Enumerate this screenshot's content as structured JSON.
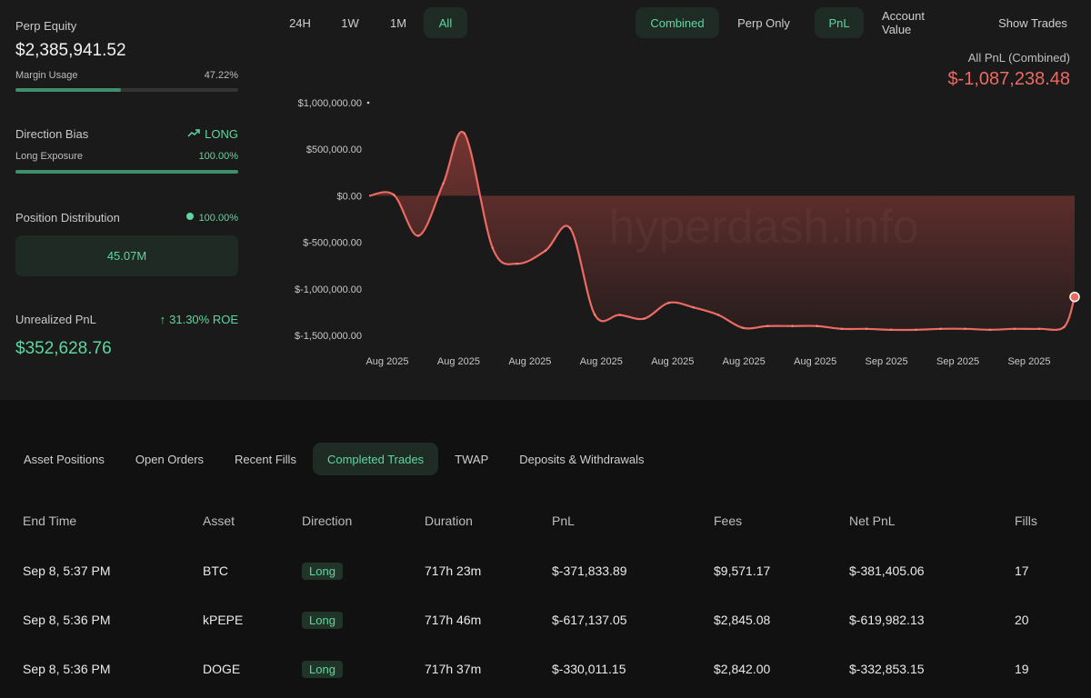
{
  "stats": {
    "perp_equity_label": "Perp Equity",
    "perp_equity_value": "$2,385,941.52",
    "margin_usage_label": "Margin Usage",
    "margin_usage_value": "47.22%",
    "margin_usage_fraction": 0.4722,
    "direction_bias_label": "Direction Bias",
    "direction_bias_value": "LONG",
    "long_exposure_label": "Long Exposure",
    "long_exposure_value": "100.00%",
    "long_exposure_fraction": 1.0,
    "position_distribution_label": "Position Distribution",
    "position_distribution_value": "100.00%",
    "position_distribution_amount": "45.07M",
    "unrealized_pnl_label": "Unrealized PnL",
    "unrealized_roe": "31.30% ROE",
    "unrealized_pnl_value": "$352,628.76"
  },
  "toolbar": {
    "range_buttons": [
      "24H",
      "1W",
      "1M",
      "All"
    ],
    "range_selected": "All",
    "mode_buttons": [
      "Combined",
      "Perp Only"
    ],
    "mode_selected": "Combined",
    "metric_buttons": [
      "PnL",
      "Account Value"
    ],
    "metric_selected": "PnL",
    "show_trades_label": "Show Trades"
  },
  "pnl_header": {
    "label": "All PnL (Combined)",
    "value": "$-1,087,238.48"
  },
  "watermark": "hyperdash.info",
  "chart_data": {
    "type": "area",
    "title": "",
    "xlabel": "",
    "ylabel": "",
    "y_ticks": [
      1000000,
      500000,
      0,
      -500000,
      -1000000,
      -1500000
    ],
    "y_tick_labels": [
      "$1,000,000.00",
      "$500,000.00",
      "$0.00",
      "$-500,000.00",
      "$-1,000,000.00",
      "$-1,500,000.00"
    ],
    "x_tick_labels": [
      "Aug 2025",
      "Aug 2025",
      "Aug 2025",
      "Aug 2025",
      "Aug 2025",
      "Aug 2025",
      "Aug 2025",
      "Sep 2025",
      "Sep 2025",
      "Sep 2025"
    ],
    "ylim": [
      -1500000,
      1000000
    ],
    "grid": false,
    "line_color": "#ec6a62",
    "series": [
      {
        "x": [
          0,
          0.035,
          0.07,
          0.105,
          0.135,
          0.175,
          0.21,
          0.25,
          0.285,
          0.32,
          0.355,
          0.39,
          0.425,
          0.46,
          0.495,
          0.53,
          0.565,
          0.6,
          0.635,
          0.67,
          0.705,
          0.74,
          0.775,
          0.81,
          0.845,
          0.88,
          0.915,
          0.95,
          0.985,
          1.0
        ],
        "values": [
          0,
          10000,
          -430000,
          130000,
          670000,
          -560000,
          -730000,
          -590000,
          -350000,
          -1280000,
          -1280000,
          -1320000,
          -1150000,
          -1200000,
          -1280000,
          -1420000,
          -1400000,
          -1400000,
          -1400000,
          -1430000,
          -1430000,
          -1440000,
          -1440000,
          -1430000,
          -1430000,
          -1440000,
          -1430000,
          -1430000,
          -1410000,
          -1087238.48
        ]
      }
    ]
  },
  "tabs": [
    "Asset Positions",
    "Open Orders",
    "Recent Fills",
    "Completed Trades",
    "TWAP",
    "Deposits & Withdrawals"
  ],
  "tab_selected": "Completed Trades",
  "table": {
    "columns": [
      "End Time",
      "Asset",
      "Direction",
      "Duration",
      "PnL",
      "Fees",
      "Net PnL",
      "Fills"
    ],
    "rows": [
      {
        "end_time": "Sep 8, 5:37 PM",
        "asset": "BTC",
        "direction": "Long",
        "duration": "717h 23m",
        "pnl": "$-371,833.89",
        "fees": "$9,571.17",
        "net_pnl": "$-381,405.06",
        "fills": "17"
      },
      {
        "end_time": "Sep 8, 5:36 PM",
        "asset": "kPEPE",
        "direction": "Long",
        "duration": "717h 46m",
        "pnl": "$-617,137.05",
        "fees": "$2,845.08",
        "net_pnl": "$-619,982.13",
        "fills": "20"
      },
      {
        "end_time": "Sep 8, 5:36 PM",
        "asset": "DOGE",
        "direction": "Long",
        "duration": "717h 37m",
        "pnl": "$-330,011.15",
        "fees": "$2,842.00",
        "net_pnl": "$-332,853.15",
        "fills": "19"
      }
    ]
  },
  "colors": {
    "accent_green": "#5fd6a0",
    "loss_red": "#ec6a62",
    "panel_bg": "#1a1a1a",
    "page_bg": "#111111"
  }
}
